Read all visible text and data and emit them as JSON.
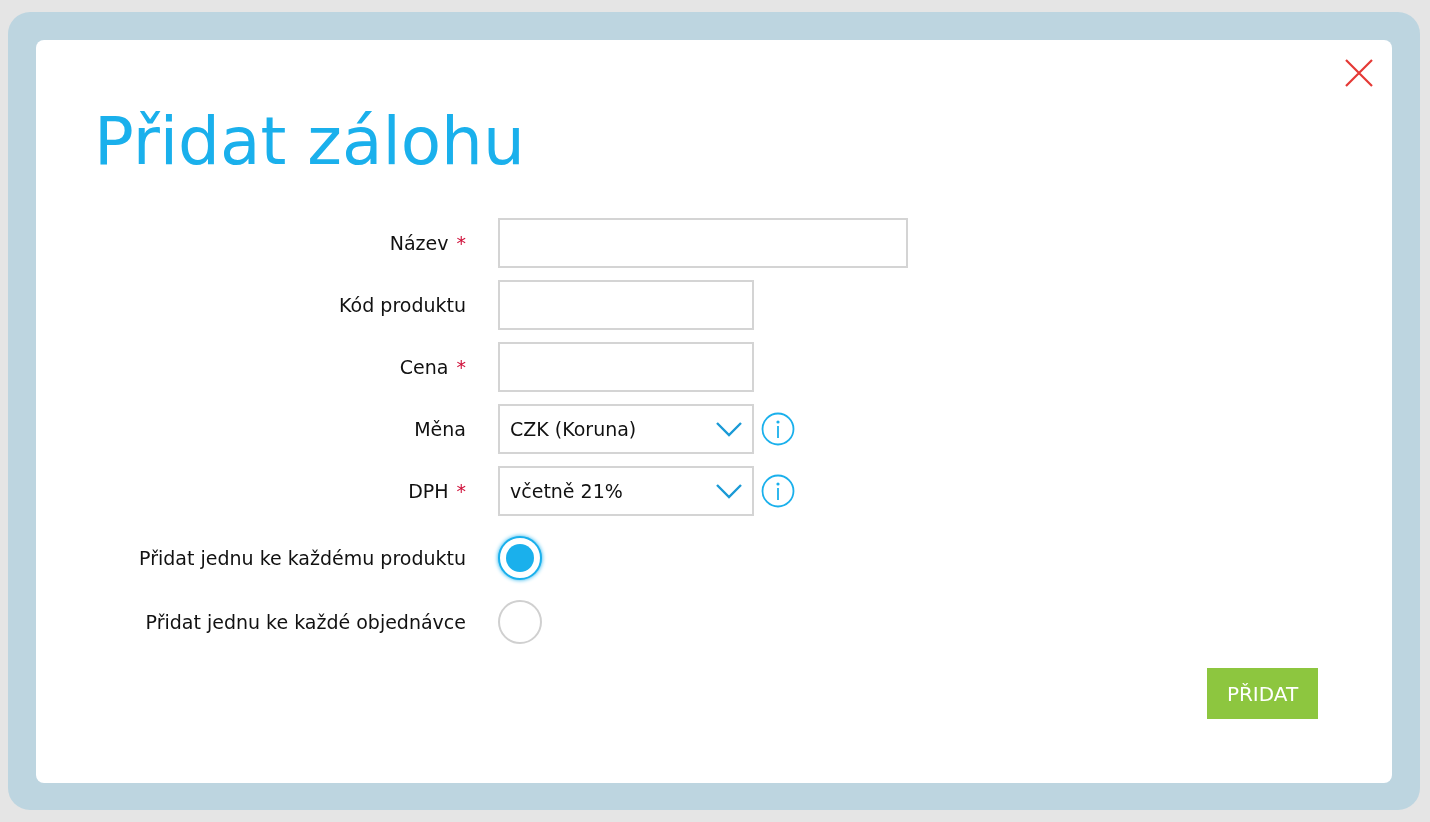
{
  "dialog": {
    "title": "Přidat zálohu",
    "required_marker": "*"
  },
  "fields": [
    {
      "kind": "wide_text",
      "label": "Název",
      "required": true
    },
    {
      "kind": "text",
      "label": "Kód produktu",
      "required": false
    },
    {
      "kind": "text",
      "label": "Cena",
      "required": true
    },
    {
      "kind": "select",
      "label": "Měna",
      "required": false,
      "value": "CZK (Koruna)",
      "info": true
    },
    {
      "kind": "select",
      "label": "DPH",
      "required": true,
      "value": "včetně 21%",
      "info": true
    }
  ],
  "options": [
    {
      "label": "Přidat jednu ke každému produktu",
      "selected": true
    },
    {
      "label": "Přidat jednu ke každé objednávce",
      "selected": false
    }
  ],
  "submit_button": "PŘIDAT"
}
